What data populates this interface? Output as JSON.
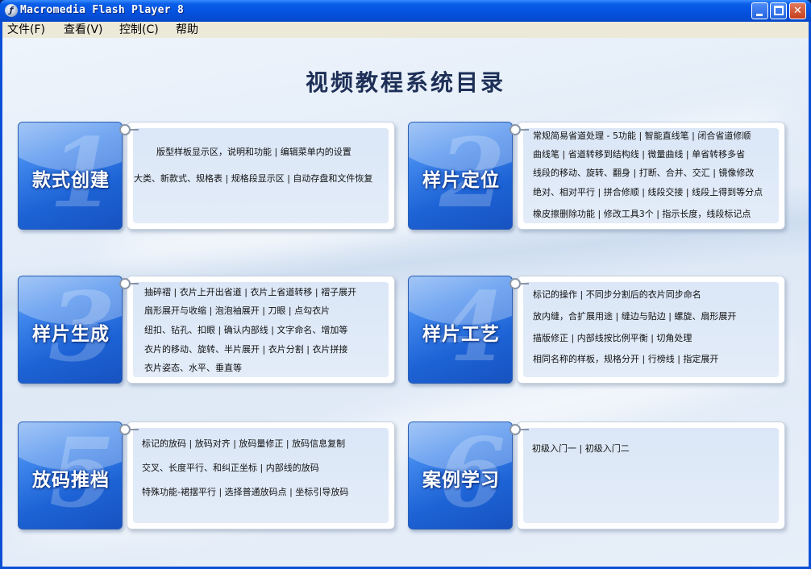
{
  "window": {
    "title": "Macromedia Flash Player 8",
    "icon": "flash-player-icon"
  },
  "menu": [
    "文件(F)",
    "查看(V)",
    "控制(C)",
    "帮助"
  ],
  "page_title": "视频教程系统目录",
  "sections": [
    {
      "number": "1",
      "label": "款式创建",
      "lines": [
        "版型样板显示区，说明和功能  |  编辑菜单内的设置",
        "大类、新款式、规格表  |  规格段显示区  |  自动存盘和文件恢复"
      ]
    },
    {
      "number": "2",
      "label": "样片定位",
      "lines": [
        "常规简易省道处理 - 5功能 | 智能直线笔 | 闭合省道修顺",
        "曲线笔 | 省道转移到结构线 | 微量曲线 |  单省转移多省",
        "线段的移动、旋转、翻身 | 打断、合并、交汇 | 镜像修改",
        "绝对、相对平行 | 拼合修顺 | 线段交接 | 线段上得到等分点",
        "橡皮擦删除功能 | 修改工具3个 | 指示长度，线段标记点"
      ]
    },
    {
      "number": "3",
      "label": "样片生成",
      "lines": [
        "抽碎褶 | 衣片上开出省道 | 衣片上省道转移 | 褶子展开",
        "扇形展开与收缩 | 泡泡袖展开 | 刀眼 | 点勾衣片",
        "纽扣、钻孔、扣眼 | 确认内部线 | 文字命名、增加等",
        "衣片的移动、旋转、半片展开 | 衣片分割 | 衣片拼接",
        "衣片姿态、水平、垂直等"
      ]
    },
    {
      "number": "4",
      "label": "样片工艺",
      "lines": [
        "标记的操作 | 不同步分割后的衣片同步命名",
        "放内缝，合扩展用途 | 缝边与贴边 | 螺旋、扇形展开",
        "描版修正 | 内部线按比例平衡 | 切角处理",
        "相同名称的样板，规格分开 | 行榜线 | 指定展开"
      ]
    },
    {
      "number": "5",
      "label": "放码推档",
      "lines": [
        "标记的放码 | 放码对齐 | 放码量修正 | 放码信息复制",
        "交叉、长度平行、和纠正坐标 | 内部线的放码",
        "特殊功能-裙摆平行 | 选择普通放码点 | 坐标引导放码"
      ]
    },
    {
      "number": "6",
      "label": "案例学习",
      "lines": [
        "初级入门一  |   初级入门二"
      ]
    }
  ]
}
